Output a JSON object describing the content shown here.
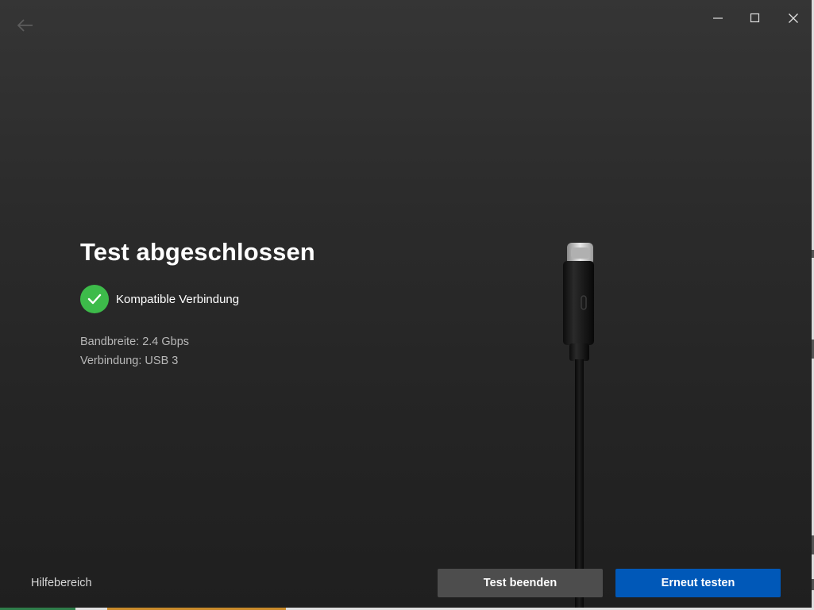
{
  "window": {
    "controls": {
      "back_icon": "arrow-left-icon",
      "minimize_icon": "minimize-icon",
      "maximize_icon": "maximize-icon",
      "close_icon": "close-icon"
    }
  },
  "main": {
    "title": "Test abgeschlossen",
    "status": {
      "icon": "check-circle-icon",
      "text": "Kompatible Verbindung",
      "color": "#3dbb4a"
    },
    "details": {
      "bandwidth": "Bandbreite: 2.4 Gbps",
      "connection": "Verbindung: USB 3"
    },
    "illustration": "usb-c-cable-illustration"
  },
  "footer": {
    "help_link": "Hilfebereich",
    "end_test_label": "Test beenden",
    "retest_label": "Erneut testen",
    "accent_color": "#0058b8"
  }
}
